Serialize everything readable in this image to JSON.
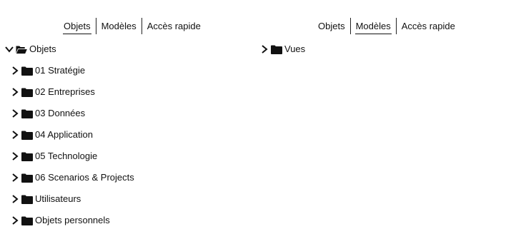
{
  "left_panel": {
    "tabs": [
      {
        "label": "Objets",
        "active": true
      },
      {
        "label": "Modèles",
        "active": false
      },
      {
        "label": "Accès rapide",
        "active": false
      }
    ],
    "root": {
      "label": "Objets",
      "expanded": true,
      "icon": "folder-open-icon"
    },
    "items": [
      {
        "label": "01 Stratégie",
        "icon": "folder-icon"
      },
      {
        "label": "02 Entreprises",
        "icon": "folder-icon"
      },
      {
        "label": "03 Données",
        "icon": "folder-icon"
      },
      {
        "label": "04 Application",
        "icon": "folder-icon"
      },
      {
        "label": "05 Technologie",
        "icon": "folder-icon"
      },
      {
        "label": "06 Scenarios & Projects",
        "icon": "folder-icon"
      },
      {
        "label": "Utilisateurs",
        "icon": "folder-icon"
      },
      {
        "label": "Objets personnels",
        "icon": "folder-icon"
      }
    ]
  },
  "right_panel": {
    "tabs": [
      {
        "label": "Objets",
        "active": false
      },
      {
        "label": "Modèles",
        "active": true
      },
      {
        "label": "Accès rapide",
        "active": false
      }
    ],
    "items": [
      {
        "label": "Vues",
        "icon": "folder-icon",
        "expanded": false
      }
    ]
  }
}
